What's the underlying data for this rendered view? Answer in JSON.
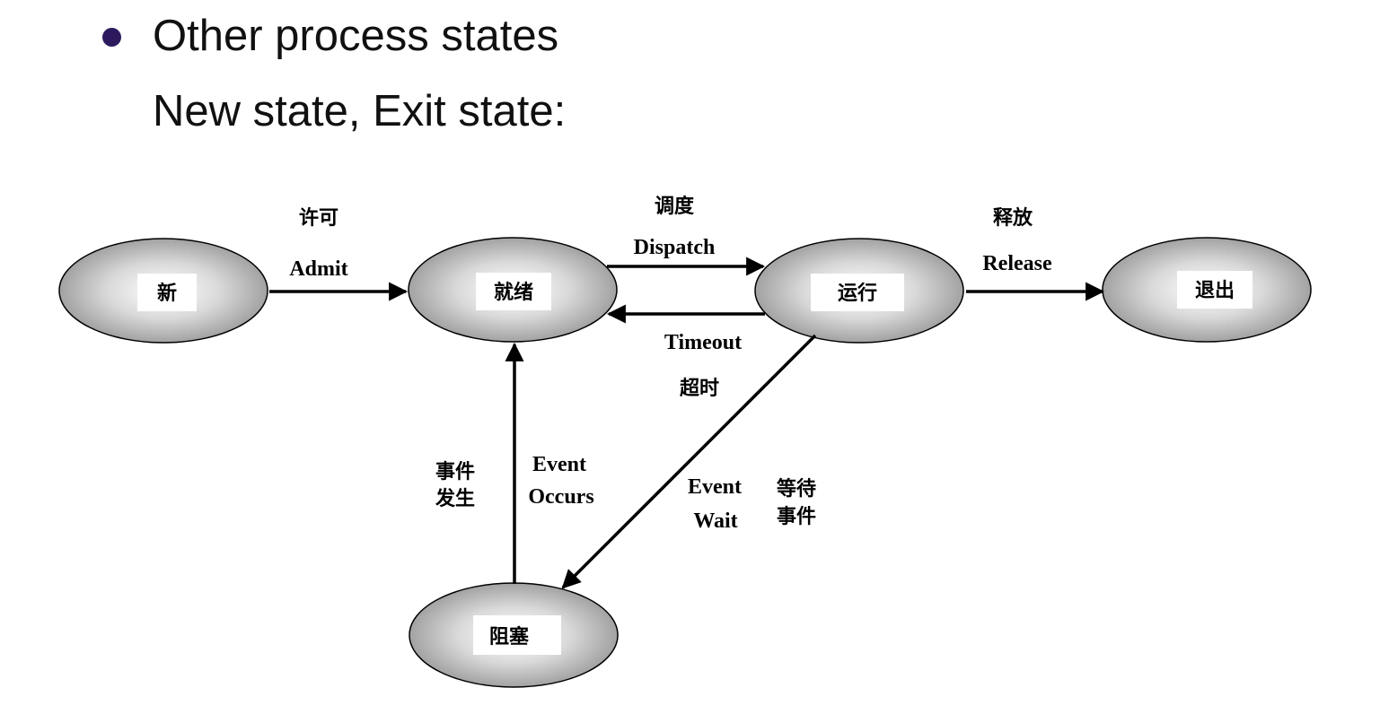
{
  "header": {
    "title": "Other process states",
    "subtitle": "New state, Exit state:"
  },
  "states": {
    "new": "新",
    "ready": "就绪",
    "running": "运行",
    "exit": "退出",
    "blocked": "阻塞"
  },
  "transitions": {
    "admit": {
      "zh": "许可",
      "en": "Admit"
    },
    "dispatch": {
      "zh": "调度",
      "en": "Dispatch"
    },
    "timeout": {
      "zh": "超时",
      "en": "Timeout"
    },
    "release": {
      "zh": "释放",
      "en": "Release"
    },
    "event_occurs": {
      "zh_line1": "事件",
      "zh_line2": "发生",
      "en_line1": "Event",
      "en_line2": "Occurs"
    },
    "event_wait": {
      "zh_line1": "等待",
      "zh_line2": "事件",
      "en_line1": "Event",
      "en_line2": "Wait"
    }
  },
  "colors": {
    "bullet": "#2d1a5e",
    "text": "#111111",
    "ellipse_light": "#ffffff",
    "ellipse_dark": "#8a8a8a",
    "stroke": "#000000"
  }
}
